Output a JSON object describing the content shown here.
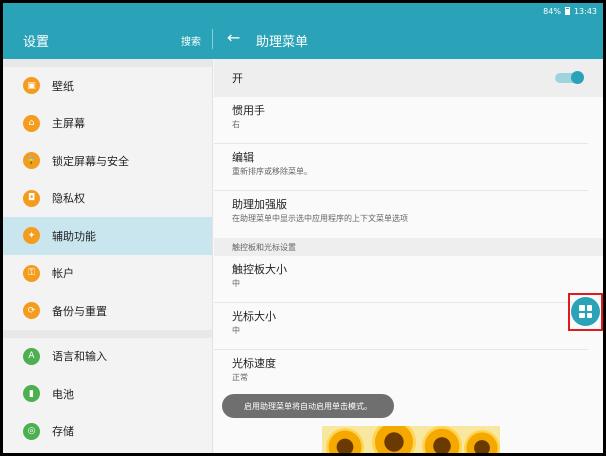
{
  "status_bar": {
    "battery": "84%",
    "time": "13:43"
  },
  "app_bar": {
    "left_title": "设置",
    "search_label": "搜索",
    "back_glyph": "←",
    "right_title": "助理菜单"
  },
  "left_panel": {
    "groups": [
      [
        {
          "label": "壁纸",
          "icon": "wallpaper-icon",
          "glyph": "▣"
        },
        {
          "label": "主屏幕",
          "icon": "home-icon",
          "glyph": "⌂"
        },
        {
          "label": "锁定屏幕与安全",
          "icon": "lock-icon",
          "glyph": "🔒"
        },
        {
          "label": "隐私权",
          "icon": "privacy-icon",
          "glyph": "◘"
        },
        {
          "label": "辅助功能",
          "icon": "accessibility-icon",
          "glyph": "✦",
          "active": true
        },
        {
          "label": "帐户",
          "icon": "key-icon",
          "glyph": "⚿"
        },
        {
          "label": "备份与重置",
          "icon": "backup-icon",
          "glyph": "⟳"
        }
      ],
      [
        {
          "label": "语言和输入",
          "icon": "language-icon",
          "glyph": "A",
          "green": true
        },
        {
          "label": "电池",
          "icon": "battery-icon",
          "glyph": "▮",
          "green": true
        },
        {
          "label": "存储",
          "icon": "storage-icon",
          "glyph": "◎",
          "green": true
        }
      ]
    ]
  },
  "right_panel": {
    "master_switch": {
      "label": "开",
      "on": true
    },
    "items": [
      {
        "title": "惯用手",
        "subtitle": "右"
      },
      {
        "title": "编辑",
        "subtitle": "重新排序或移除菜单。"
      },
      {
        "title": "助理加强版",
        "subtitle": "在助理菜单中显示选中应用程序的上下文菜单选项"
      }
    ],
    "section_header": "触控板和光标设置",
    "cursor_items": [
      {
        "title": "触控板大小",
        "subtitle": "中"
      },
      {
        "title": "光标大小",
        "subtitle": "中"
      },
      {
        "title": "光标速度",
        "subtitle": "正常"
      }
    ],
    "toast": "启用助理菜单将自动启用单击模式。"
  },
  "colors": {
    "accent": "#2aa3b8",
    "icon_orange": "#f39c1d",
    "icon_green": "#4caf50",
    "highlight": "#e01b1b"
  }
}
